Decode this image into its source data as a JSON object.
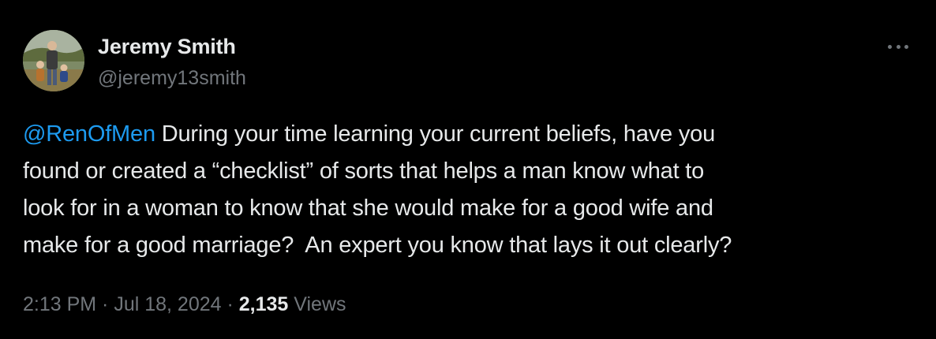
{
  "author": {
    "name": "Jeremy Smith",
    "handle": "@jeremy13smith",
    "avatar_icon": "avatar-photo"
  },
  "more_icon": "more-options-icon",
  "tweet": {
    "mention": "@RenOfMen",
    "lines": [
      " During your time learning your current beliefs, have you",
      "found or created a “checklist” of sorts that helps a man know what to",
      "look for in a woman to know that she would make for a good wife and",
      "make for a good marriage?  An expert you know that lays it out clearly?"
    ]
  },
  "meta": {
    "time": "2:13 PM",
    "separator": " · ",
    "date": "Jul 18, 2024",
    "views_count": "2,135",
    "views_label": " Views"
  },
  "colors": {
    "background": "#000000",
    "text": "#e7e9ea",
    "secondary": "#71767b",
    "link": "#1d9bf0"
  }
}
